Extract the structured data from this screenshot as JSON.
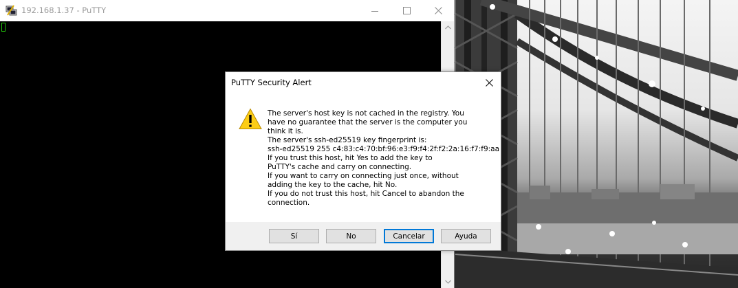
{
  "window": {
    "title": "192.168.1.37 - PuTTY",
    "app_icon": "putty-icon",
    "controls": [
      "minimize-icon",
      "maximize-icon",
      "close-icon"
    ]
  },
  "terminal": {
    "background": "#000000",
    "cursor_color": "#22c80a"
  },
  "dialog": {
    "title": "PuTTY Security Alert",
    "icon": "warning-icon",
    "message_lines": [
      "The server's host key is not cached in the registry. You",
      "have no guarantee that the server is the computer you",
      "think it is.",
      "The server's ssh-ed25519 key fingerprint is:",
      "ssh-ed25519 255 c4:83:c4:70:bf:96:e3:f9:f4:2f:f2:2a:16:f7:f9:aa",
      "If you trust this host, hit Yes to add the key to",
      "PuTTY's cache and carry on connecting.",
      "If you want to carry on connecting just once, without",
      "adding the key to the cache, hit No.",
      "If you do not trust this host, hit Cancel to abandon the",
      "connection."
    ],
    "buttons": {
      "yes": "Sí",
      "no": "No",
      "cancel": "Cancelar",
      "help": "Ayuda"
    },
    "default_button_color": "#0078d7"
  }
}
